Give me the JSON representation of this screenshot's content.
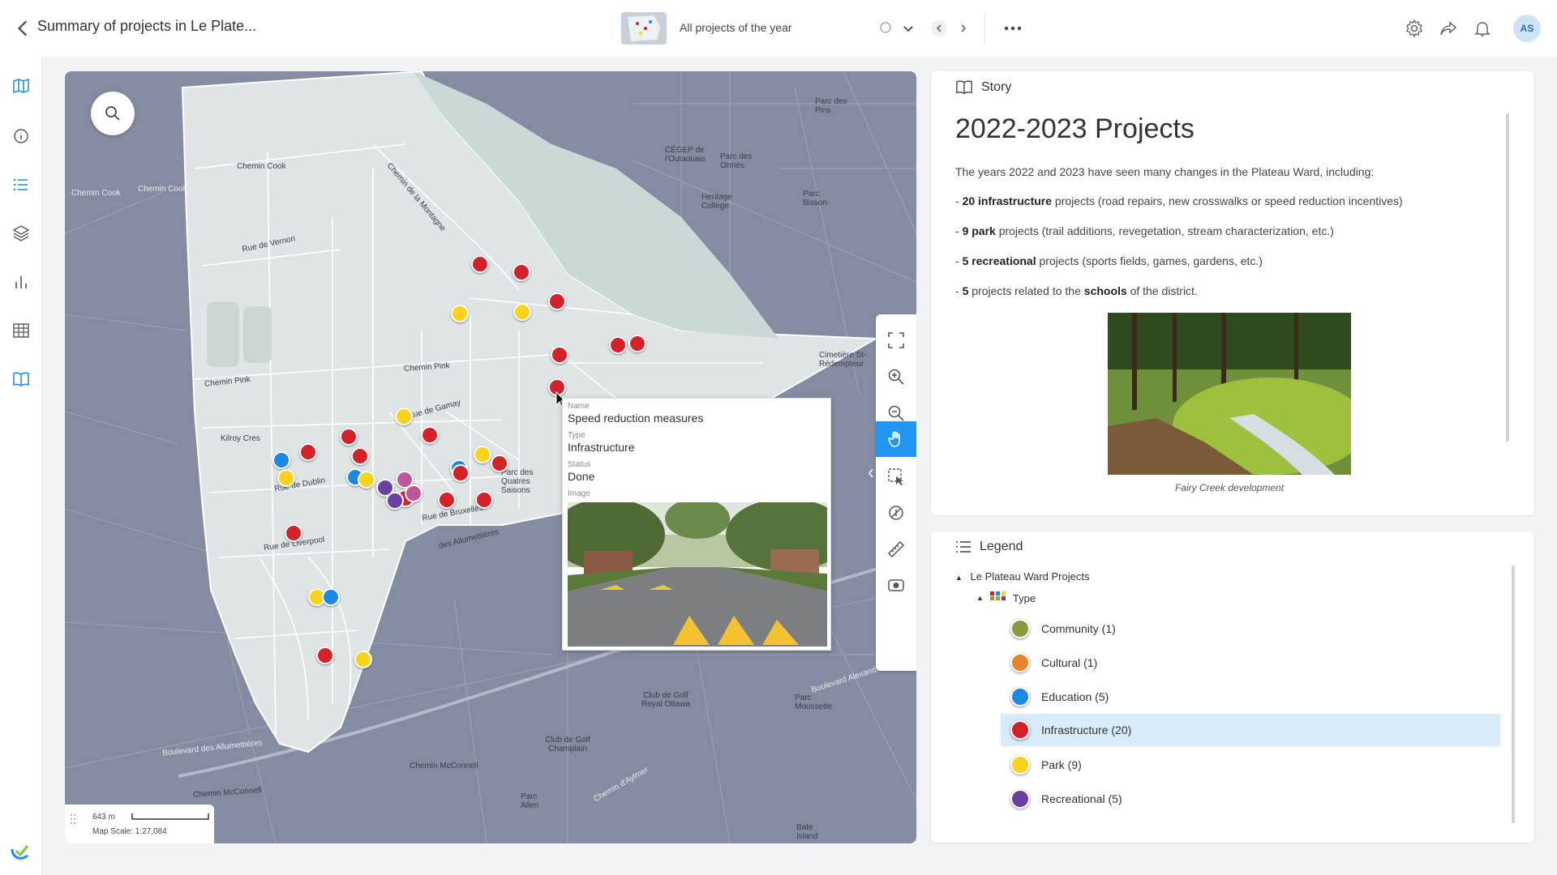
{
  "header": {
    "title": "Summary of projects in Le Plate...",
    "view_name": "All projects of the year",
    "avatar_initials": "AS"
  },
  "map": {
    "popup": {
      "name_label": "Name",
      "name_value": "Speed reduction measures",
      "type_label": "Type",
      "type_value": "Infrastructure",
      "status_label": "Status",
      "status_value": "Done",
      "image_label": "Image"
    },
    "scale": {
      "distance": "643 m",
      "label": "Map Scale: 1:27,084"
    },
    "labels": {
      "chemin_cook_1": "Chemin Cook",
      "chemin_cook_2": "Chemin Cook",
      "chemin_cook_3": "Chemin Cook",
      "rue_de_vernon": "Rue de Vernon",
      "chemin_pink_1": "Chemin Pink",
      "chemin_pink_2": "Chemin Pink",
      "kilroy_cres": "Kilroy Cres",
      "rue_de_gamay": "Rue de Gamay",
      "rue_de_dublin": "Rue de Dublin",
      "rue_de_bruxelles": "Rue de Bruxelles",
      "rue_de_liverpool": "Rue de Liverpool",
      "des_allumettieres": "des Allumettières",
      "boulevard_allumettieres": "Boulevard des Allumettières",
      "cegep": "CÉGEP de l'Outaouais",
      "parc_ormes": "Parc des Ormes",
      "heritage_college": "Heritage College",
      "parc_bisson": "Parc Bisson",
      "parc_des_pins": "Parc des Pins",
      "cimetiere": "Cimetière St-Rédempteur",
      "club_golf_ottawa": "Club de Golf Royal Ottawa",
      "club_golf_champlain": "Club de Golf Champlain",
      "parc_moussette": "Parc Moussette",
      "parc_allen": "Parc Allen",
      "chemin_mcconnell_1": "Chemin McConnell",
      "chemin_mcconnell_2": "Chemin McConnell",
      "bate_island": "Bate Island",
      "boulevard_alexandre": "Boulevard Alexandre-Taché",
      "parc_des_quatre_saisons": "Parc des Quatres Saisons",
      "chemin_de_la_montagne": "Chemin de la Montagne",
      "chemin_daylmer": "Chemin d'Aylmer"
    }
  },
  "story": {
    "header": "Story",
    "title": "2022-2023 Projects",
    "intro": "The years 2022 and 2023 have seen many changes in the Plateau Ward, including:",
    "items": [
      {
        "prefix": "- ",
        "bold": "20 infrastructure",
        "rest": " projects (road repairs, new crosswalks or speed reduction incentives)"
      },
      {
        "prefix": "- ",
        "bold": "9 park",
        "rest": " projects (trail additions, revegetation, stream characterization, etc.)"
      },
      {
        "prefix": "- ",
        "bold": "5 recreational",
        "rest": " projects (sports fields, games, gardens, etc.)"
      },
      {
        "prefix": "- ",
        "bold": "5",
        "rest": " projects related to the ",
        "bold2": "schools",
        "rest2": " of the district."
      }
    ],
    "caption": "Fairy Creek development"
  },
  "legend": {
    "header": "Legend",
    "group": "Le Plateau Ward Projects",
    "type_label": "Type",
    "items": [
      {
        "label": "Community (1)",
        "color": "#8b9a3c"
      },
      {
        "label": "Cultural (1)",
        "color": "#e8842c"
      },
      {
        "label": "Education (5)",
        "color": "#1e88e5"
      },
      {
        "label": "Infrastructure (20)",
        "color": "#d32029"
      },
      {
        "label": "Park (9)",
        "color": "#f9d21c"
      },
      {
        "label": "Recreational (5)",
        "color": "#6b3fa0"
      }
    ]
  },
  "colors": {
    "accent": "#2196f3",
    "selected_row": "#d7ebfb",
    "map_water": "#858ca2",
    "map_zone": "#dfe4e5"
  },
  "icons": {
    "nav": [
      "map-icon",
      "info-icon",
      "list-icon",
      "layers-icon",
      "chart-icon",
      "table-icon",
      "book-icon"
    ],
    "tools": [
      "fullscreen-icon",
      "zoom-in-icon",
      "zoom-out-icon",
      "pan-hand-icon",
      "select-icon",
      "rotate-icon",
      "measure-icon",
      "camera-icon"
    ]
  }
}
